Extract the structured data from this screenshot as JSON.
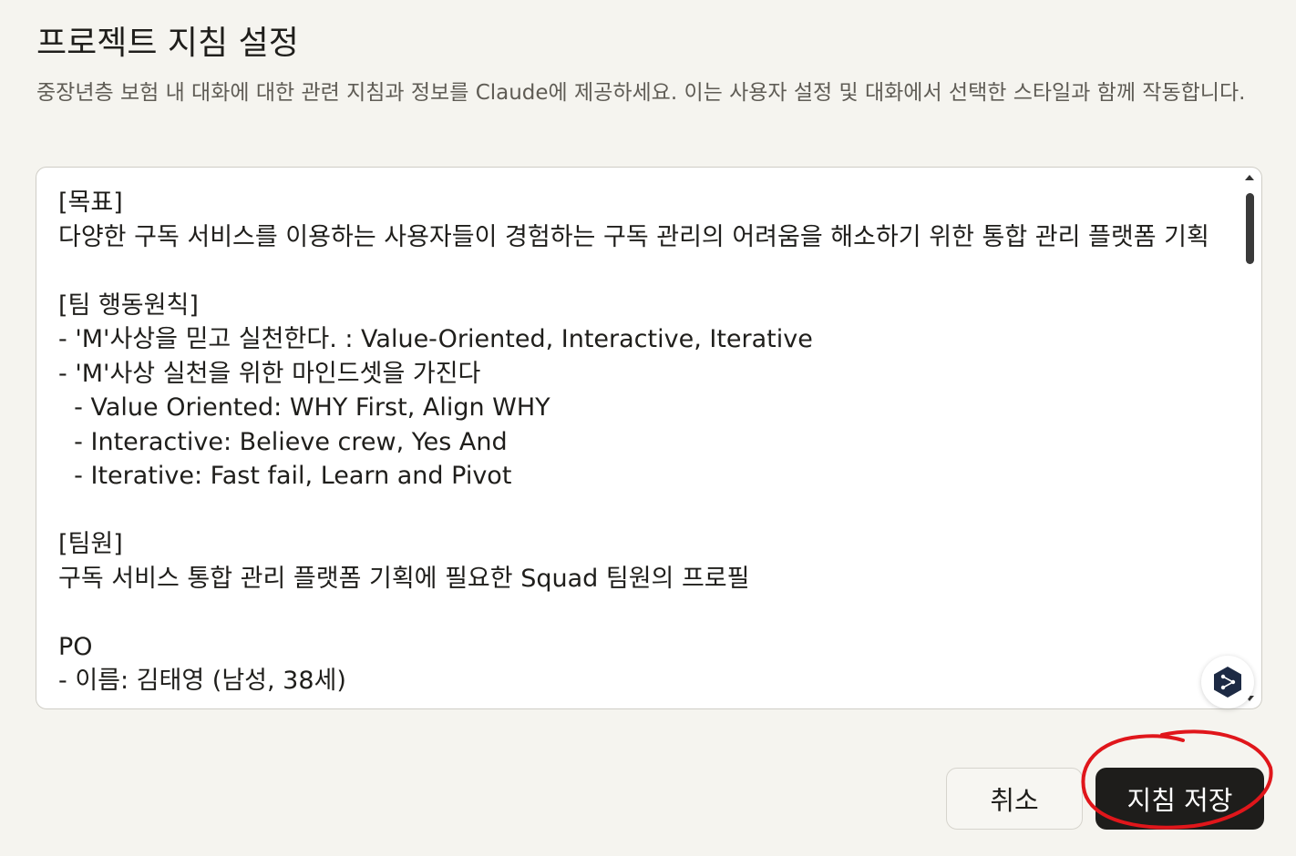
{
  "dialog": {
    "title": "프로젝트 지침 설정",
    "description": "중장년층 보험 내 대화에 대한 관련 지침과 정보를 Claude에 제공하세요. 이는 사용자 설정 및 대화에서 선택한 스타일과 함께 작동합니다."
  },
  "editor": {
    "content": "[목표]\n다양한 구독 서비스를 이용하는 사용자들이 경험하는 구독 관리의 어려움을 해소하기 위한 통합 관리 플랫폼 기획\n\n[팀 행동원칙]\n- 'M'사상을 믿고 실천한다. : Value-Oriented, Interactive, Iterative\n- 'M'사상 실천을 위한 마인드셋을 가진다\n  - Value Oriented: WHY First, Align WHY\n  - Interactive: Believe crew, Yes And\n  - Iterative: Fast fail, Learn and Pivot\n\n[팀원]\n구독 서비스 통합 관리 플랫폼 기획에 필요한 Squad 팀원의 프로필\n\nPO\n- 이름: 김태영 (남성, 38세)"
  },
  "buttons": {
    "cancel": "취소",
    "save": "지침 저장"
  },
  "colors": {
    "background": "#f5f4ef",
    "save_button": "#1e1d1b",
    "annotation": "#e0161b",
    "fab_icon": "#1d2a44"
  },
  "icons": {
    "fab": "share-nodes-icon"
  }
}
